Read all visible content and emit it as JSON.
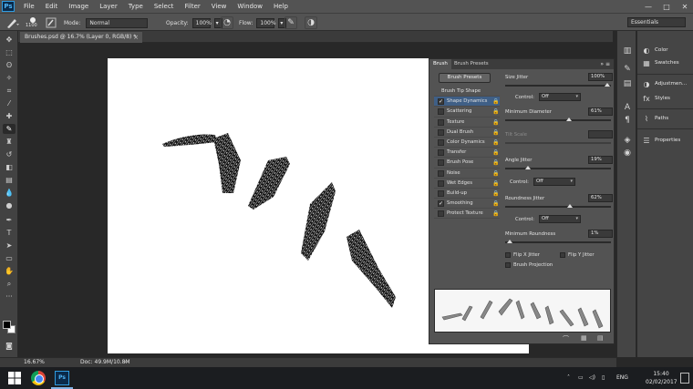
{
  "app": {
    "logo": "Ps"
  },
  "menu": [
    "File",
    "Edit",
    "Image",
    "Layer",
    "Type",
    "Select",
    "Filter",
    "View",
    "Window",
    "Help"
  ],
  "window_controls": {
    "minimize": "—",
    "maximize": "□",
    "close": "✕"
  },
  "options": {
    "brush_size": "1100",
    "mode_label": "Mode:",
    "mode_value": "Normal",
    "opacity_label": "Opacity:",
    "opacity_value": "100%",
    "flow_label": "Flow:",
    "flow_value": "100%",
    "workspace": "Essentials"
  },
  "document": {
    "tab_title": "Brushes.psd @ 16.7% (Layer 0, RGB/8) *",
    "tab_close": "×"
  },
  "brush_panel": {
    "tabs": [
      "Brush",
      "Brush Presets"
    ],
    "menu_glyph": "»  ≡",
    "presets_button": "Brush Presets",
    "list": [
      {
        "label": "Brush Tip Shape",
        "header": true
      },
      {
        "label": "Shape Dynamics",
        "checked": true,
        "active": true
      },
      {
        "label": "Scattering",
        "checked": false
      },
      {
        "label": "Texture",
        "checked": false
      },
      {
        "label": "Dual Brush",
        "checked": false
      },
      {
        "label": "Color Dynamics",
        "checked": false
      },
      {
        "label": "Transfer",
        "checked": false
      },
      {
        "label": "Brush Pose",
        "checked": false
      },
      {
        "label": "Noise",
        "checked": false
      },
      {
        "label": "Wet Edges",
        "checked": false
      },
      {
        "label": "Build-up",
        "checked": false
      },
      {
        "label": "Smoothing",
        "checked": true
      },
      {
        "label": "Protect Texture",
        "checked": false
      }
    ],
    "size_jitter": {
      "label": "Size Jitter",
      "value": "100%",
      "level": 1.0
    },
    "control_label": "Control:",
    "control_1": "Off",
    "min_diameter": {
      "label": "Minimum Diameter",
      "value": "61%",
      "level": 0.61
    },
    "tilt_scale": {
      "label": "Tilt Scale",
      "value": "",
      "level": 0.0
    },
    "angle_jitter": {
      "label": "Angle Jitter",
      "value": "19%",
      "level": 0.19
    },
    "control_2": "Off",
    "roundness_jitter": {
      "label": "Roundness Jitter",
      "value": "62%",
      "level": 0.62
    },
    "control_3": "Off",
    "min_roundness": {
      "label": "Minimum Roundness",
      "value": "1%",
      "level": 0.01
    },
    "flip_x": {
      "label": "Flip X Jitter",
      "checked": false
    },
    "flip_y": {
      "label": "Flip Y Jitter",
      "checked": false
    },
    "brush_projection": {
      "label": "Brush Projection",
      "checked": false
    }
  },
  "dock": [
    {
      "label": "Color",
      "icon": "color-icon"
    },
    {
      "label": "Swatches",
      "icon": "swatches-icon"
    },
    {
      "label": "Adjustmen...",
      "icon": "adjustments-icon"
    },
    {
      "label": "Styles",
      "icon": "styles-icon"
    },
    {
      "label": "Paths",
      "icon": "paths-icon"
    },
    {
      "label": "Properties",
      "icon": "properties-icon"
    }
  ],
  "status": {
    "zoom": "16.67%",
    "doc_size": "Doc: 49.9M/10.8M",
    "arrow": "›"
  },
  "taskbar": {
    "ps_label": "Ps",
    "lang": "ENG",
    "time": "15:40",
    "date": "02/02/2017"
  }
}
